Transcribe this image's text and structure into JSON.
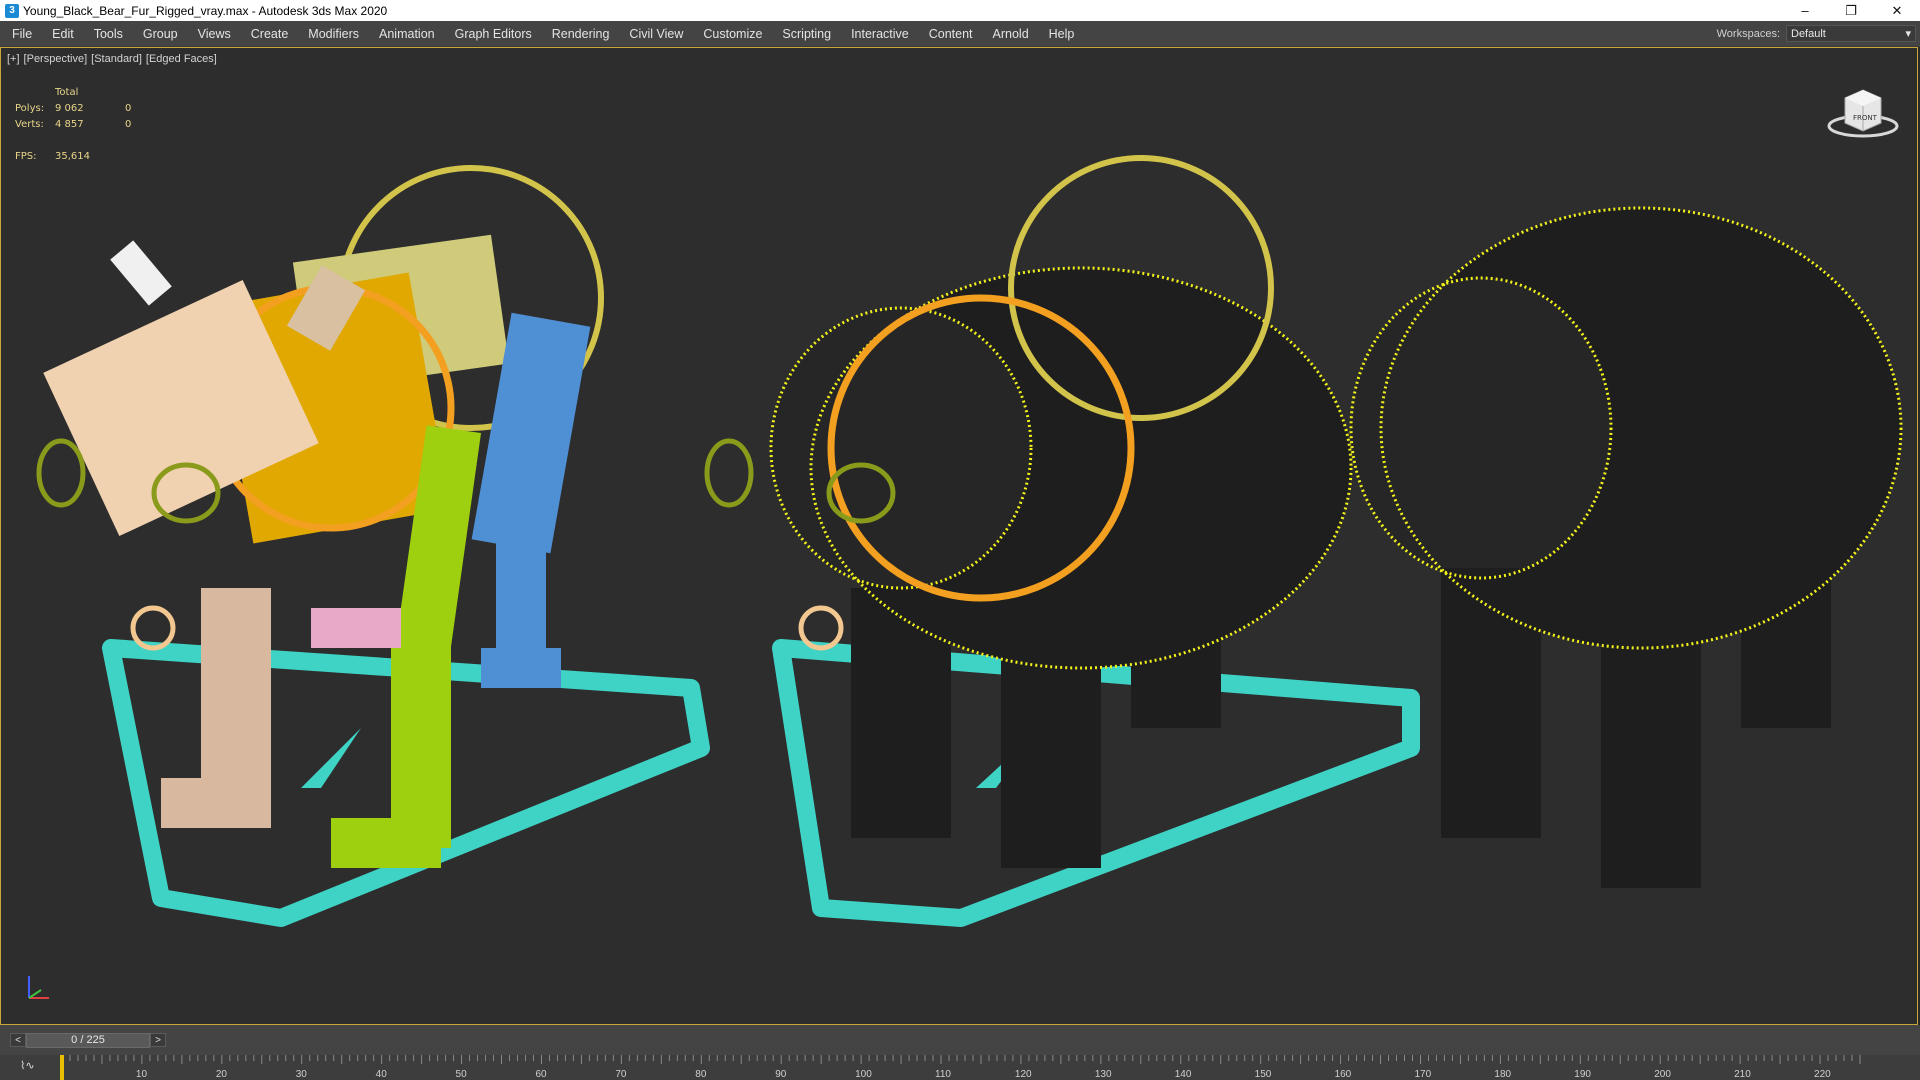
{
  "window": {
    "title": "Young_Black_Bear_Fur_Rigged_vray.max - Autodesk 3ds Max 2020",
    "app_icon": "3",
    "controls": [
      "–",
      "❐",
      "✕"
    ]
  },
  "menu": {
    "items": [
      "File",
      "Edit",
      "Tools",
      "Group",
      "Views",
      "Create",
      "Modifiers",
      "Animation",
      "Graph Editors",
      "Rendering",
      "Civil View",
      "Customize",
      "Scripting",
      "Interactive",
      "Content",
      "Arnold",
      "Help"
    ],
    "workspace_label": "Workspaces:",
    "workspace_value": "Default"
  },
  "viewport": {
    "labels": [
      "[+]",
      "[Perspective]",
      "[Standard]",
      "[Edged Faces]"
    ],
    "stats": {
      "header": "Total",
      "polys_label": "Polys:",
      "polys_total": "9 062",
      "polys_sel": "0",
      "verts_label": "Verts:",
      "verts_total": "4 857",
      "verts_sel": "0",
      "fps_label": "FPS:",
      "fps_value": "35,614"
    },
    "viewcube_label": "FRONT",
    "colors": {
      "border": "#c9a53a",
      "fur": "#f2f21a",
      "control_path": "#3fd3c6",
      "stats_text": "#e8d58a"
    }
  },
  "timeline": {
    "prev": "<",
    "next": ">",
    "position": "0 / 225",
    "current_frame": 0,
    "total_frames": 225,
    "ticks": [
      "10",
      "20",
      "30",
      "40",
      "50",
      "60",
      "70",
      "80",
      "90",
      "100",
      "110",
      "120",
      "130",
      "140",
      "150",
      "160",
      "170",
      "180",
      "190",
      "200",
      "210",
      "220"
    ]
  }
}
